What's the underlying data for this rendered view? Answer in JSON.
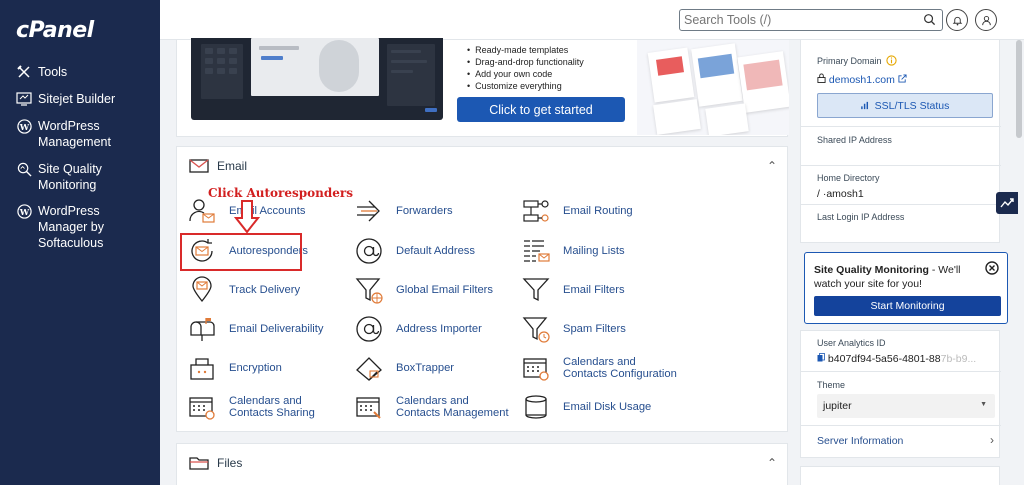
{
  "brand": {
    "logo": "cPanel"
  },
  "sidebar": {
    "items": [
      {
        "label": "Tools",
        "icon": "tools-icon"
      },
      {
        "label": "Sitejet Builder",
        "icon": "sitejet-icon"
      },
      {
        "label": "WordPress Management",
        "icon": "wordpress-icon"
      },
      {
        "label": "Site Quality Monitoring",
        "icon": "magnifier-icon"
      },
      {
        "label": "WordPress Manager by Softaculous",
        "icon": "wordpress-icon"
      }
    ]
  },
  "topbar": {
    "search_placeholder": "Search Tools (/)"
  },
  "banner": {
    "bullets": [
      "Ready-made templates",
      "Drag-and-drop functionality",
      "Add your own code",
      "Customize everything"
    ],
    "cta_label": "Click to get started"
  },
  "email": {
    "title": "Email",
    "tools": [
      {
        "label": "Email Accounts",
        "icon": "user-mail-icon"
      },
      {
        "label": "Forwarders",
        "icon": "forward-arrow-icon"
      },
      {
        "label": "Email Routing",
        "icon": "routing-icon"
      },
      {
        "label": "Autoresponders",
        "icon": "autoresponder-icon"
      },
      {
        "label": "Default Address",
        "icon": "at-sign-icon"
      },
      {
        "label": "Mailing Lists",
        "icon": "mailing-list-icon"
      },
      {
        "label": "Track Delivery",
        "icon": "location-pin-icon"
      },
      {
        "label": "Global Email Filters",
        "icon": "global-filter-icon"
      },
      {
        "label": "Email Filters",
        "icon": "filter-icon"
      },
      {
        "label": "Email Deliverability",
        "icon": "mailbox-icon"
      },
      {
        "label": "Address Importer",
        "icon": "at-import-icon"
      },
      {
        "label": "Spam Filters",
        "icon": "spam-filter-icon"
      },
      {
        "label": "Encryption",
        "icon": "encryption-icon"
      },
      {
        "label": "BoxTrapper",
        "icon": "boxtrapper-icon"
      },
      {
        "label": "Calendars and Contacts Configuration",
        "icon": "calendar-gear-icon"
      },
      {
        "label": "Calendars and Contacts Sharing",
        "icon": "calendar-share-icon"
      },
      {
        "label": "Calendars and Contacts Management",
        "icon": "calendar-manage-icon"
      },
      {
        "label": "Email Disk Usage",
        "icon": "disk-usage-icon"
      }
    ]
  },
  "files": {
    "title": "Files"
  },
  "annotation": {
    "text": "Click Autoresponders"
  },
  "account": {
    "primary_domain_label": "Primary Domain",
    "primary_domain": "demosh1.com",
    "ssl_label": "SSL/TLS Status",
    "shared_ip_label": "Shared IP Address",
    "home_dir_label": "Home Directory",
    "home_dir": "/           ·amosh1",
    "last_login_label": "Last Login IP Address"
  },
  "sqm": {
    "title": "Site Quality Monitoring",
    "text": " - We'll watch your site for you!",
    "button": "Start Monitoring"
  },
  "analytics": {
    "label": "User Analytics ID",
    "value": "b407df94-5a56-4801-88",
    "value_faded": "7b-b9...",
    "theme_label": "Theme",
    "theme_value": "jupiter",
    "server_info": "Server Information"
  },
  "colors": {
    "sidebar": "#1b2a4e",
    "accent": "#1c58b3",
    "annotation": "#d92a2a",
    "icon_orange": "#e07b39"
  }
}
